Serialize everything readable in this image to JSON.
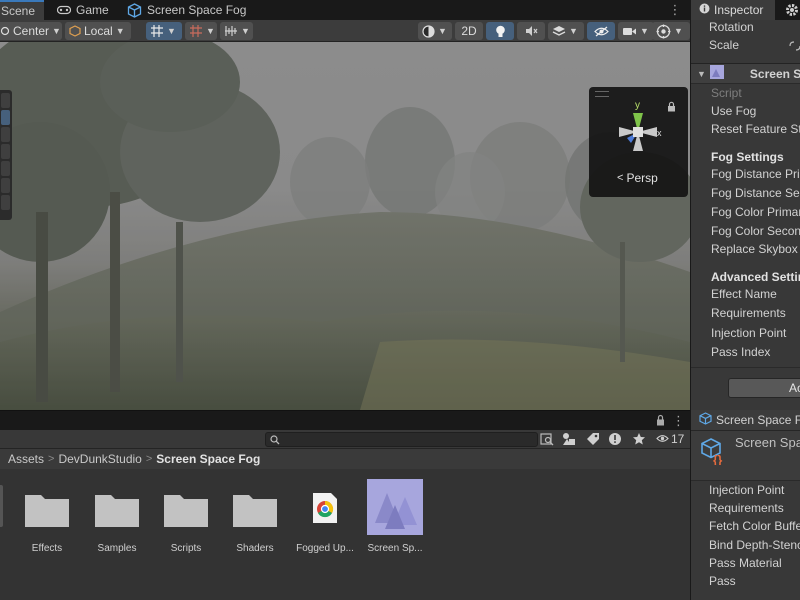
{
  "scene_tabs": {
    "scene": "Scene",
    "game": "Game",
    "screen_space_fog": "Screen Space Fog"
  },
  "scene_toolbar": {
    "pivot_mode": "Center",
    "pivot_space": "Local",
    "mode_2d": "2D"
  },
  "gizmo": {
    "axis_y": "y",
    "axis_x": "x",
    "projection": "Persp"
  },
  "project": {
    "search_placeholder": "",
    "visibility_count": "17",
    "breadcrumb": [
      "Assets",
      "DevDunkStudio",
      "Screen Space Fog"
    ],
    "assets": [
      {
        "name": "Effects",
        "type": "folder"
      },
      {
        "name": "Samples",
        "type": "folder"
      },
      {
        "name": "Scripts",
        "type": "folder"
      },
      {
        "name": "Shaders",
        "type": "folder"
      },
      {
        "name": "Fogged Up...",
        "type": "link"
      },
      {
        "name": "Screen Sp...",
        "type": "asset"
      }
    ]
  },
  "inspector": {
    "tab": "Inspector",
    "transform_rows": [
      "Rotation",
      "Scale"
    ],
    "component_title": "Screen Sp",
    "script_label": "Script",
    "use_fog": "Use Fog",
    "reset_feature": "Reset Feature Sta",
    "fog_settings_header": "Fog Settings",
    "fog_rows": [
      "Fog Distance Prim",
      "Fog Distance Seco",
      "Fog Color Primary",
      "Fog Color Second",
      "Replace Skybox"
    ],
    "advanced_header": "Advanced Setting",
    "advanced_rows": [
      "Effect Name",
      "Requirements",
      "Injection Point",
      "Pass Index"
    ],
    "add_button": "Ac"
  },
  "inspector2": {
    "tab": "Screen Space F",
    "title": "Screen Spa",
    "rows": [
      "Injection Point",
      "Requirements",
      "Fetch Color Buffe",
      "Bind Depth-Stenc",
      "Pass Material",
      "Pass"
    ]
  },
  "colors": {
    "accent": "#3a79bb",
    "panel": "#383838",
    "fog_asset": "#a7a6dd"
  }
}
